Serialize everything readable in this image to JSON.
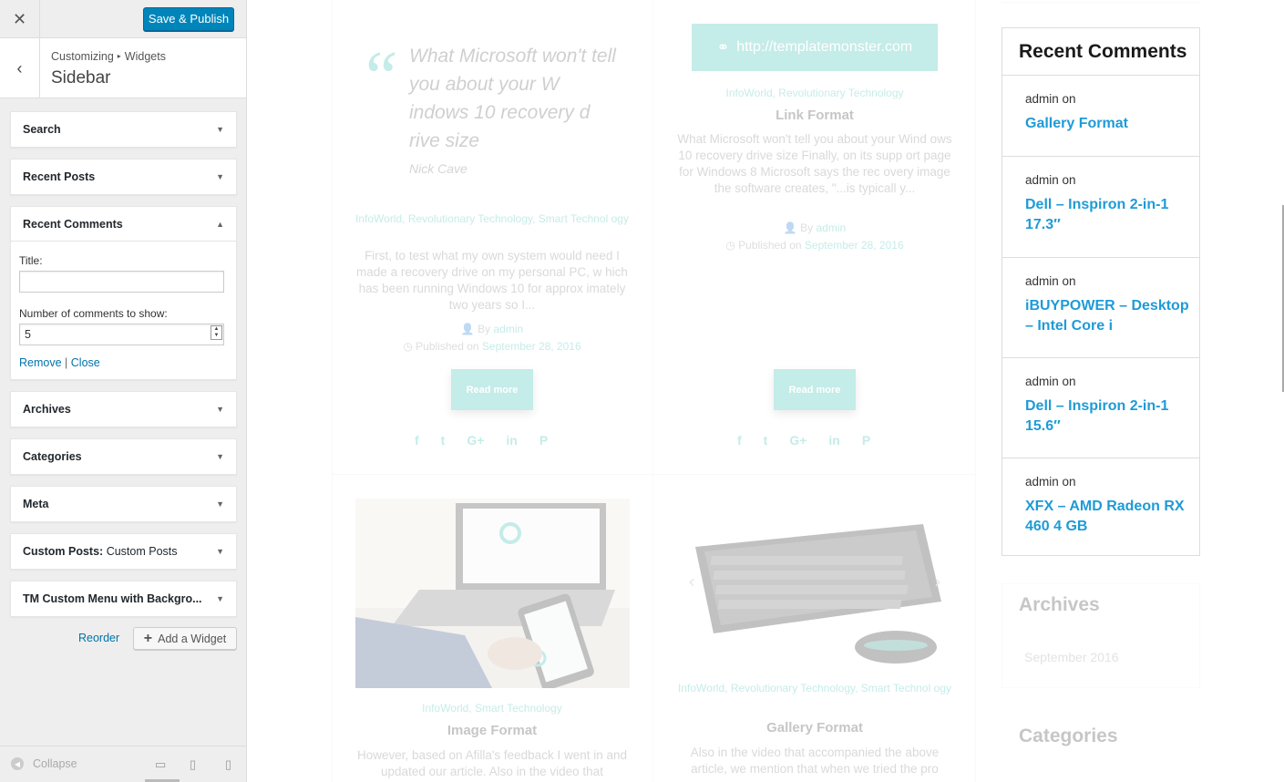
{
  "customizer": {
    "close_icon": "close-icon",
    "publish_label": "Save & Publish",
    "breadcrumb": [
      "Customizing",
      "Widgets"
    ],
    "breadcrumb_separator": "▸",
    "section_title": "Sidebar",
    "widgets": [
      {
        "title": "Search",
        "subtitle": ""
      },
      {
        "title": "Recent Posts",
        "subtitle": ""
      },
      {
        "title": "Recent Comments",
        "subtitle": "",
        "expanded": true
      },
      {
        "title": "Archives",
        "subtitle": ""
      },
      {
        "title": "Categories",
        "subtitle": ""
      },
      {
        "title": "Meta",
        "subtitle": ""
      },
      {
        "title": "Custom Posts:",
        "subtitle": "Custom Posts"
      },
      {
        "title": "TM Custom Menu with Backgro...",
        "subtitle": ""
      }
    ],
    "form": {
      "title_label": "Title:",
      "title_value": "",
      "number_label": "Number of comments to show:",
      "number_value": "5",
      "remove_label": "Remove",
      "close_label": "Close",
      "link_separator": "|"
    },
    "reorder_label": "Reorder",
    "add_widget_label": "Add a Widget",
    "collapse_label": "Collapse",
    "accent_color": "#0085ba"
  },
  "preview": {
    "quote_post": {
      "quote": "What Microsoft won't tell you about your W indows 10 recovery d rive size",
      "author": "Nick Cave",
      "categories": "InfoWorld, Revolutionary Technology, Smart Technol ogy",
      "excerpt": "First, to test what my own system would need I made a recovery drive on my personal PC, w hich has been running Windows 10 for approx imately two years so I...",
      "by": "By",
      "author_link": "admin",
      "published": "Published on",
      "date": "September 28, 2016",
      "read_more": "Read more"
    },
    "link_post": {
      "link": "http://templatemonster.com",
      "categories": "InfoWorld, Revolutionary Technology",
      "title": "Link Format",
      "excerpt": "What Microsoft won't tell you about your Wind ows 10 recovery drive size Finally, on its supp ort page for Windows 8 Microsoft says the rec overy image the software creates, \"...is typicall y...",
      "by": "By",
      "author_link": "admin",
      "published": "Published on",
      "date": "September 28, 2016",
      "read_more": "Read more"
    },
    "image_post": {
      "categories": "InfoWorld, Smart Technology",
      "title": "Image Format",
      "excerpt": "However, based on Afilla's feedback I went in and updated our article. Also in the video that"
    },
    "gallery_post": {
      "categories": "InfoWorld, Revolutionary Technology, Smart Technol ogy",
      "title": "Gallery Format",
      "excerpt": "Also in the video that accompanied the above article, we mention that when we tried the pro"
    },
    "social_icons": [
      "facebook-icon",
      "twitter-icon",
      "google-plus-icon",
      "linkedin-icon",
      "pinterest-icon"
    ],
    "recent_comments": {
      "title": "Recent Comments",
      "items": [
        {
          "author": "admin",
          "on": "on",
          "post": "Gallery Format"
        },
        {
          "author": "admin",
          "on": "on",
          "post": "Dell – Inspiron 2-in-1 17.3″"
        },
        {
          "author": "admin",
          "on": "on",
          "post": "iBUYPOWER – Desktop – Intel Core i"
        },
        {
          "author": "admin",
          "on": "on",
          "post": "Dell – Inspiron 2-in-1 15.6″"
        },
        {
          "author": "admin",
          "on": "on",
          "post": "XFX – AMD Radeon RX 460 4 GB"
        }
      ],
      "link_color": "#1e9bd7"
    },
    "archives": {
      "title": "Archives",
      "items": [
        "September 2016"
      ]
    },
    "categories_title": "Categories",
    "theme_accent": "#2bbbad"
  }
}
